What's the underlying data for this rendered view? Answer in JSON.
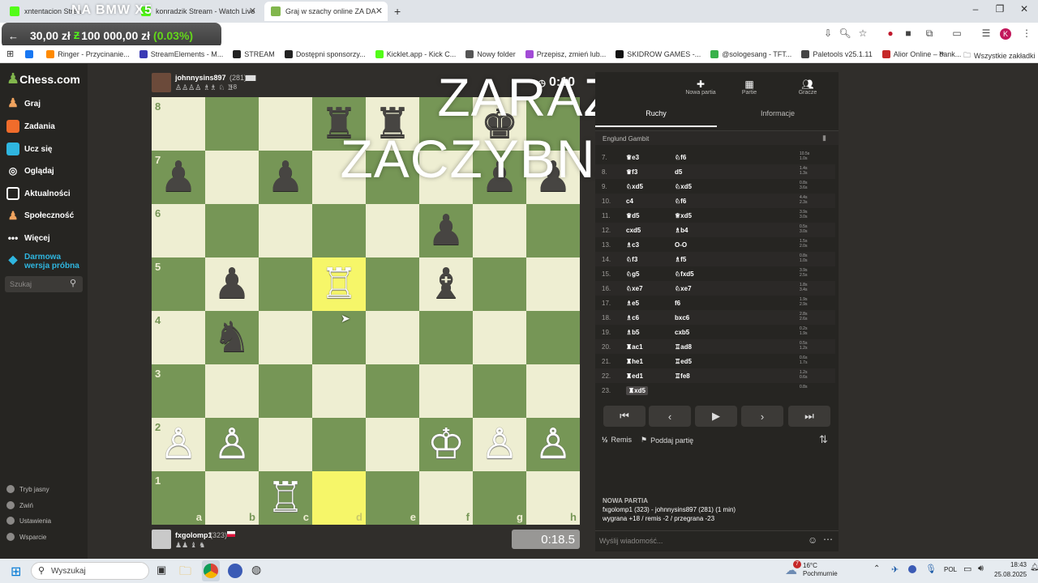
{
  "browser": {
    "tabs": [
      {
        "label": "xntentacion Strea",
        "favicon_color": "#53fc18"
      },
      {
        "label": "konradzik Stream - Watch Live",
        "favicon_color": "#53fc18"
      },
      {
        "label": "Graj w szachy online ZA DA",
        "favicon_color": "#81b64c"
      }
    ],
    "new_tab": "+",
    "window_controls": [
      "–",
      "❐",
      "✕"
    ],
    "bookmarks": [
      {
        "label": "",
        "color": "#1877f2"
      },
      {
        "label": "Ringer - Przycinanie...",
        "color": "#ff8a00"
      },
      {
        "label": "StreamElements - M...",
        "color": "#3b3bb5"
      },
      {
        "label": "STREAM",
        "color": "#222222"
      },
      {
        "label": "Dostępni sponsorzy...",
        "color": "#222222"
      },
      {
        "label": "Kicklet.app - Kick C...",
        "color": "#53fc18"
      },
      {
        "label": "Nowy folder",
        "color": "#555555"
      },
      {
        "label": "Przepisz, zmień lub...",
        "color": "#a24bd6"
      },
      {
        "label": "SKIDROW GAMES -...",
        "color": "#111111"
      },
      {
        "label": "@sologesang - TFT...",
        "color": "#38b14a"
      },
      {
        "label": "Paletools v25.1.11",
        "color": "#444444"
      },
      {
        "label": "Alior Online – bank...",
        "color": "#c62828"
      }
    ],
    "all_bookmarks": "Wszystkie zakładki"
  },
  "overlay": {
    "title": "NA BMW X5",
    "ticker_value": "30,00 zł",
    "ticker_target": "100 000,00 zł",
    "ticker_percent": "(0.03%)",
    "ticker_percent_color": "#63d71a",
    "headline": "ZARAZ ZACZYBNAMY"
  },
  "sidebar": {
    "logo": "Chess.com",
    "items": [
      {
        "label": "Graj",
        "icon": "pawn-icon",
        "color": "#f0a35e"
      },
      {
        "label": "Zadania",
        "icon": "puzzle-icon",
        "color": "#f06c2b"
      },
      {
        "label": "Ucz się",
        "icon": "learn-icon",
        "color": "#2fb6e0"
      },
      {
        "label": "Oglądaj",
        "icon": "binoculars-icon",
        "color": "#ffffff"
      },
      {
        "label": "Aktualności",
        "icon": "news-icon",
        "color": "#ffffff"
      },
      {
        "label": "Społeczność",
        "icon": "community-icon",
        "color": "#f0a35e"
      },
      {
        "label": "Więcej",
        "icon": "more-icon",
        "color": "#ffffff"
      }
    ],
    "trial": "Darmowa wersja próbna",
    "search_placeholder": "Szukaj",
    "bottom": [
      "Tryb jasny",
      "Zwiń",
      "Ustawienia",
      "Wsparcie"
    ]
  },
  "game": {
    "top_player": {
      "name": "johnnysins897",
      "rating": "(281)",
      "material": "+8"
    },
    "bottom_player": {
      "name": "fxgolomp1",
      "rating": "(323)"
    },
    "top_clock": "0:10",
    "bottom_clock": "0:18.5",
    "board": {
      "ranks": [
        "8",
        "7",
        "6",
        "5",
        "4",
        "3",
        "2",
        "1"
      ],
      "files": [
        "a",
        "b",
        "c",
        "d",
        "e",
        "f",
        "g",
        "h"
      ],
      "highlighted": [
        "d5",
        "d1"
      ],
      "pieces": [
        {
          "sq": "d8",
          "glyph": "♜",
          "side": "b"
        },
        {
          "sq": "e8",
          "glyph": "♜",
          "side": "b"
        },
        {
          "sq": "g8",
          "glyph": "♚",
          "side": "b"
        },
        {
          "sq": "a7",
          "glyph": "♟",
          "side": "b"
        },
        {
          "sq": "c7",
          "glyph": "♟",
          "side": "b"
        },
        {
          "sq": "g7",
          "glyph": "♟",
          "side": "b"
        },
        {
          "sq": "h7",
          "glyph": "♟",
          "side": "b"
        },
        {
          "sq": "f6",
          "glyph": "♟",
          "side": "b"
        },
        {
          "sq": "b5",
          "glyph": "♟",
          "side": "b"
        },
        {
          "sq": "d5",
          "glyph": "♖",
          "side": "w"
        },
        {
          "sq": "f5",
          "glyph": "♝",
          "side": "b"
        },
        {
          "sq": "b4",
          "glyph": "♞",
          "side": "b"
        },
        {
          "sq": "a2",
          "glyph": "♙",
          "side": "w"
        },
        {
          "sq": "b2",
          "glyph": "♙",
          "side": "w"
        },
        {
          "sq": "f2",
          "glyph": "♔",
          "side": "w"
        },
        {
          "sq": "g2",
          "glyph": "♙",
          "side": "w"
        },
        {
          "sq": "h2",
          "glyph": "♙",
          "side": "w"
        },
        {
          "sq": "c1",
          "glyph": "♖",
          "side": "w"
        }
      ]
    }
  },
  "panel": {
    "top_actions": [
      "Nowa partia",
      "Partie",
      "Gracze"
    ],
    "tabs": [
      "Ruchy",
      "Informacje"
    ],
    "opening": "Englund Gambit",
    "moves": [
      {
        "n": "7.",
        "w": "♛e3",
        "b": "♘f6"
      },
      {
        "n": "8.",
        "w": "♛f3",
        "b": "d5"
      },
      {
        "n": "9.",
        "w": "♘xd5",
        "b": "♘xd5"
      },
      {
        "n": "10.",
        "w": "c4",
        "b": "♘f6"
      },
      {
        "n": "11.",
        "w": "♛d5",
        "b": "♕xd5"
      },
      {
        "n": "12.",
        "w": "cxd5",
        "b": "♗b4"
      },
      {
        "n": "13.",
        "w": "♗c3",
        "b": "O-O"
      },
      {
        "n": "14.",
        "w": "♘f3",
        "b": "♗f5"
      },
      {
        "n": "15.",
        "w": "♘g5",
        "b": "♘fxd5"
      },
      {
        "n": "16.",
        "w": "♘xe7",
        "b": "♘xe7"
      },
      {
        "n": "17.",
        "w": "♗e5",
        "b": "f6"
      },
      {
        "n": "18.",
        "w": "♗c6",
        "b": "bxc6"
      },
      {
        "n": "19.",
        "w": "♗b5",
        "b": "cxb5"
      },
      {
        "n": "20.",
        "w": "♜ac1",
        "b": "♖ad8"
      },
      {
        "n": "21.",
        "w": "♜he1",
        "b": "♖ed5"
      },
      {
        "n": "22.",
        "w": "♜ed1",
        "b": "♖fe8"
      },
      {
        "n": "23.",
        "w": "♜xd5",
        "b": ""
      }
    ],
    "move_times": [
      [
        "10.5s",
        "1.0s"
      ],
      [
        "1.4s",
        "1.3s"
      ],
      [
        "0.8s",
        "3.6s"
      ],
      [
        "4.4s",
        "2.3s"
      ],
      [
        "3.9s",
        "3.0s"
      ],
      [
        "0.5s",
        "3.0s"
      ],
      [
        "1.5s",
        "2.0s"
      ],
      [
        "0.8s",
        "1.0s"
      ],
      [
        "3.9s",
        "2.5s"
      ],
      [
        "1.8s",
        "3.4s"
      ],
      [
        "1.9s",
        "2.9s"
      ],
      [
        "2.8s",
        "2.6s"
      ],
      [
        "0.2s",
        "1.9s"
      ],
      [
        "0.5s",
        "1.2s"
      ],
      [
        "0.6s",
        "1.7s"
      ],
      [
        "1.2s",
        "0.6s"
      ],
      [
        "0.8s",
        ""
      ]
    ],
    "nav_buttons": [
      "⏮",
      "‹",
      "▶",
      "›",
      "⏭"
    ],
    "draw": "Remis",
    "resign": "Poddaj partię",
    "new_game_title": "NOWA PARTIA",
    "new_game_players": "fxgolomp1 (323) - johnnysins897 (281) (1 min)",
    "new_game_stats": "wygrana +18 / remis -2 / przegrana -23",
    "chat_placeholder": "Wyślij wiadomość..."
  },
  "taskbar": {
    "search_placeholder": "Wyszukaj",
    "weather_temp": "16°C",
    "weather_desc": "Pochmurnie",
    "weather_badge": "7",
    "lang": "POL",
    "time": "18:43",
    "date": "25.08.2025"
  }
}
